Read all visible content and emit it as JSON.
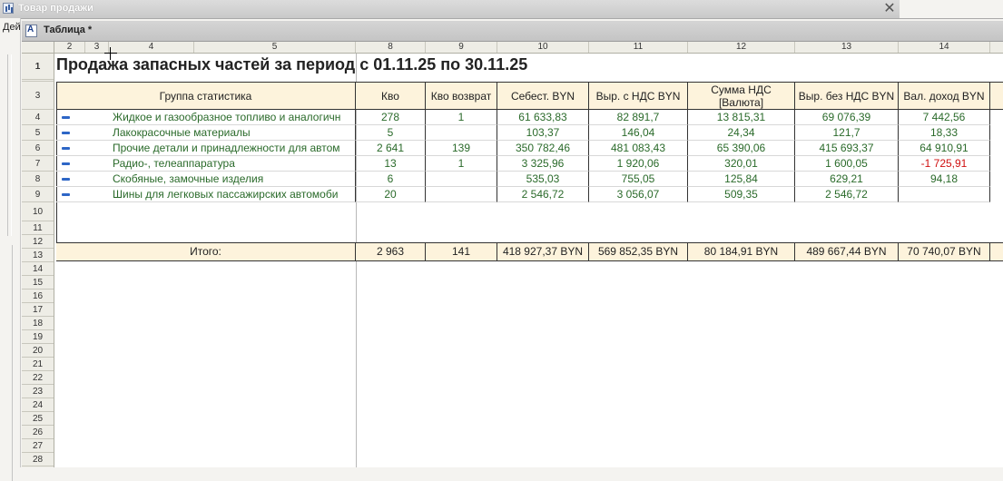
{
  "window": {
    "title": "Товар продажи",
    "close_glyph": "✕"
  },
  "sidebar": {
    "label": "Дей"
  },
  "document": {
    "tab_title": "Таблица *"
  },
  "sheet": {
    "column_headers": [
      "2",
      "3",
      "4",
      "5",
      "8",
      "9",
      "10",
      "11",
      "12",
      "13",
      "14"
    ],
    "row_headers": [
      "1",
      "",
      "3",
      "4",
      "5",
      "6",
      "7",
      "8",
      "9",
      "10",
      "11",
      "12",
      "13",
      "14",
      "15",
      "16",
      "17",
      "18",
      "19",
      "20",
      "21",
      "22",
      "23",
      "24",
      "25",
      "26",
      "27",
      "28"
    ],
    "report_title": "Продажа запасных частей за период с 01.11.25 по 30.11.25",
    "table_headers": [
      "Группа статистика",
      "Кво",
      "Кво возврат",
      "Себест. BYN",
      "Выр. с НДС BYN",
      "Сумма НДС [Валюта]",
      "Выр. без НДС BYN",
      "Вал. доход BYN"
    ],
    "rows": [
      {
        "group": "Жидкое и газообразное топливо и аналогичн",
        "qty": "278",
        "ret": "1",
        "cost": "61 633,83",
        "rev_vat": "82 891,7",
        "vat": "13 815,31",
        "rev_novat": "69 076,39",
        "income": "7 442,56"
      },
      {
        "group": "Лакокрасочные материалы",
        "qty": "5",
        "ret": "",
        "cost": "103,37",
        "rev_vat": "146,04",
        "vat": "24,34",
        "rev_novat": "121,7",
        "income": "18,33"
      },
      {
        "group": "Прочие детали и принадлежности для автом",
        "qty": "2 641",
        "ret": "139",
        "cost": "350 782,46",
        "rev_vat": "481 083,43",
        "vat": "65 390,06",
        "rev_novat": "415 693,37",
        "income": "64 910,91"
      },
      {
        "group": "Радио-, телеаппаратура",
        "qty": "13",
        "ret": "1",
        "cost": "3 325,96",
        "rev_vat": "1 920,06",
        "vat": "320,01",
        "rev_novat": "1 600,05",
        "income": "-1 725,91"
      },
      {
        "group": "Скобяные, замочные изделия",
        "qty": "6",
        "ret": "",
        "cost": "535,03",
        "rev_vat": "755,05",
        "vat": "125,84",
        "rev_novat": "629,21",
        "income": "94,18"
      },
      {
        "group": "Шины для легковых пассажирских автомоби",
        "qty": "20",
        "ret": "",
        "cost": "2 546,72",
        "rev_vat": "3 056,07",
        "vat": "509,35",
        "rev_novat": "2 546,72",
        "income": ""
      }
    ],
    "totals": {
      "label": "Итого:",
      "qty": "2 963",
      "ret": "141",
      "cost": "418 927,37 BYN",
      "rev_vat": "569 852,35 BYN",
      "vat": "80 184,91 BYN",
      "rev_novat": "489 667,44 BYN",
      "income": "70 740,07 BYN"
    },
    "colors": {
      "value_text": "#2a6a2a",
      "negative_text": "#d01010",
      "header_band": "#fdf3dc",
      "collapse_icon": "#2d66c6"
    }
  }
}
